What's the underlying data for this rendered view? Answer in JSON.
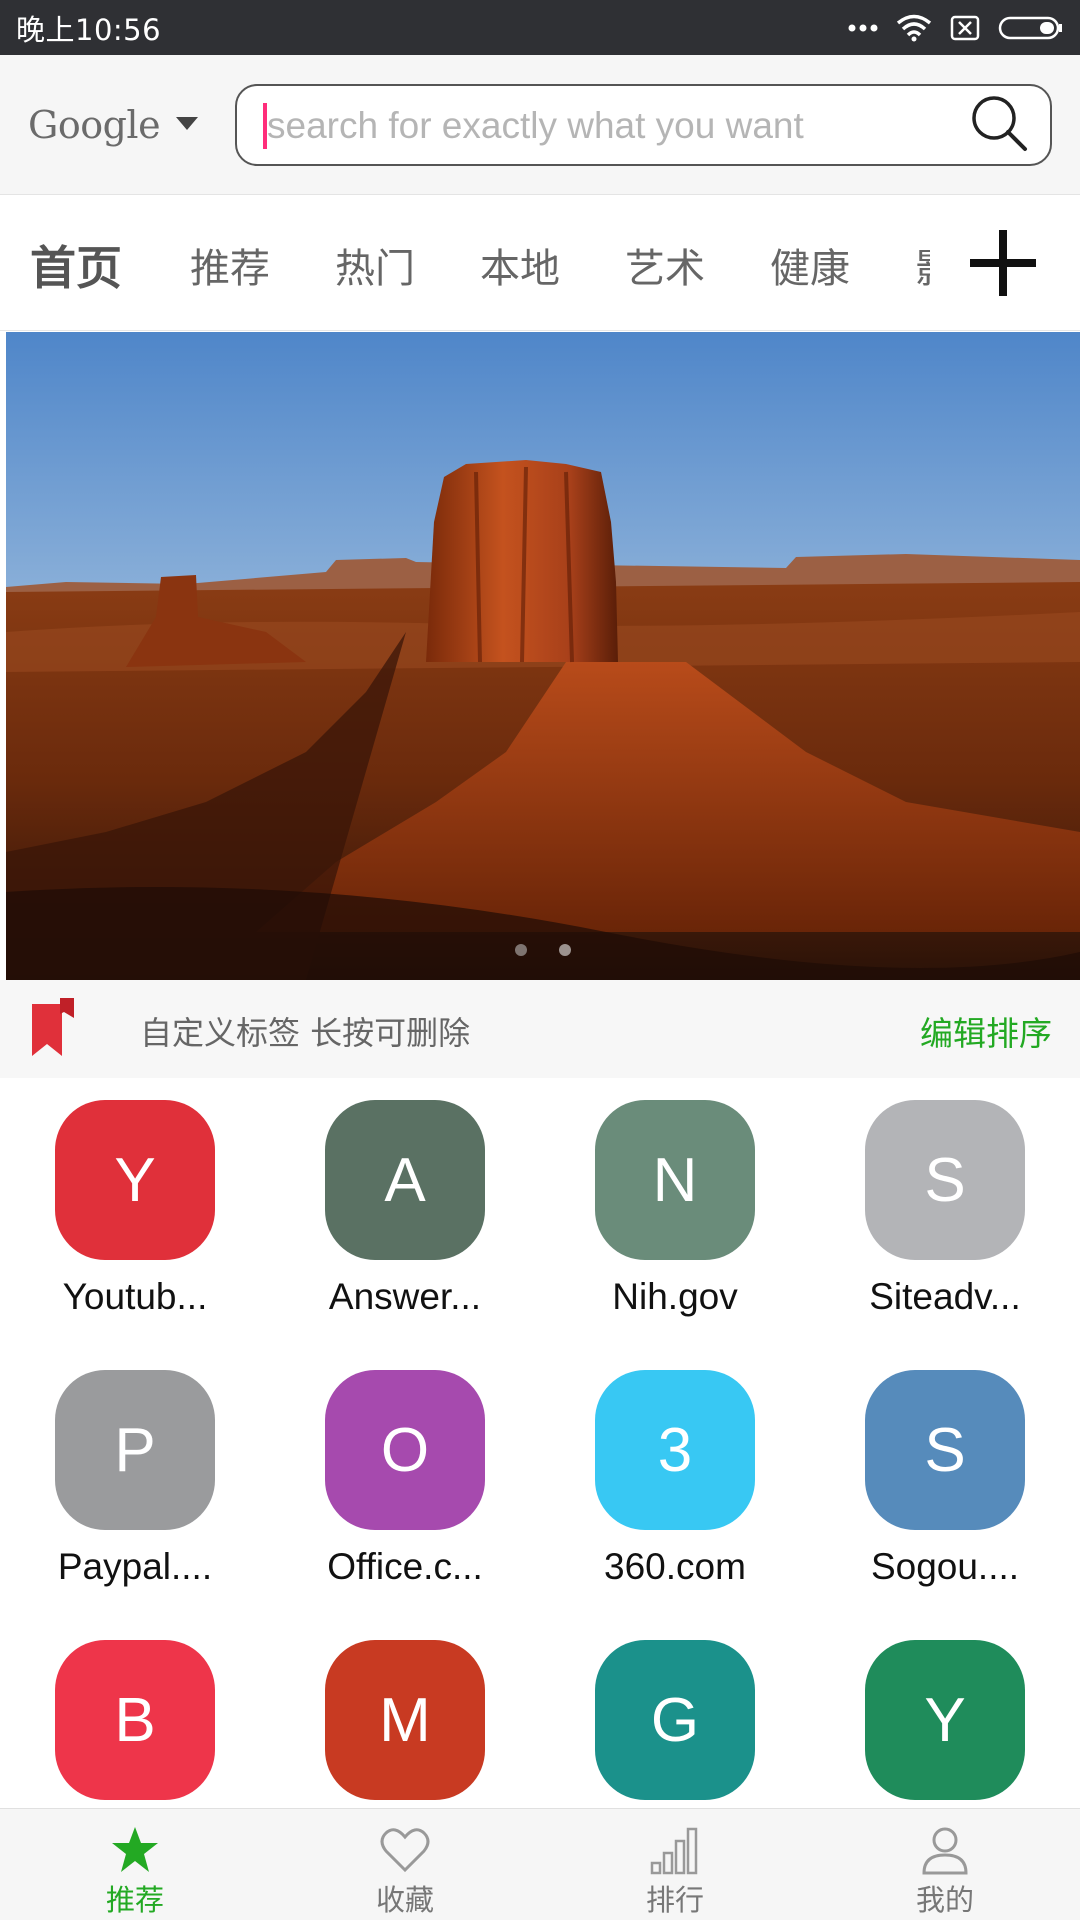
{
  "status_bar": {
    "time": "晚上10:56"
  },
  "search": {
    "engine": "Google",
    "placeholder": "search for exactly what you want"
  },
  "tabs": [
    {
      "label": "首页",
      "active": true
    },
    {
      "label": "推荐"
    },
    {
      "label": "热门"
    },
    {
      "label": "本地"
    },
    {
      "label": "艺术"
    },
    {
      "label": "健康"
    },
    {
      "label": "影"
    }
  ],
  "banner": {
    "pages": 2,
    "current": 1
  },
  "tag_bar": {
    "text": "自定义标签 长按可删除",
    "edit_label": "编辑排序"
  },
  "shortcuts": [
    {
      "letter": "Y",
      "label": "Youtub...",
      "color": "#e0303a"
    },
    {
      "letter": "A",
      "label": "Answer...",
      "color": "#5a7163"
    },
    {
      "letter": "N",
      "label": "Nih.gov",
      "color": "#6a8c7a"
    },
    {
      "letter": "S",
      "label": "Siteadv...",
      "color": "#b3b4b7"
    },
    {
      "letter": "P",
      "label": "Paypal....",
      "color": "#9a9b9d"
    },
    {
      "letter": "O",
      "label": "Office.c...",
      "color": "#a64aae"
    },
    {
      "letter": "3",
      "label": "360.com",
      "color": "#38c8f3"
    },
    {
      "letter": "S",
      "label": "Sogou....",
      "color": "#568bbb"
    },
    {
      "letter": "B",
      "label": "",
      "color": "#ee354a"
    },
    {
      "letter": "M",
      "label": "",
      "color": "#c83a22"
    },
    {
      "letter": "G",
      "label": "",
      "color": "#1b918b"
    },
    {
      "letter": "Y",
      "label": "",
      "color": "#1f8c5b"
    }
  ],
  "bottom_nav": [
    {
      "label": "推荐",
      "icon": "star-icon",
      "active": true
    },
    {
      "label": "收藏",
      "icon": "heart-icon"
    },
    {
      "label": "排行",
      "icon": "ranking-bars-icon"
    },
    {
      "label": "我的",
      "icon": "user-icon"
    }
  ],
  "colors": {
    "accent_green": "#23a923",
    "bookmark_red": "#e0303a",
    "caret_pink": "#ff2d7a"
  }
}
